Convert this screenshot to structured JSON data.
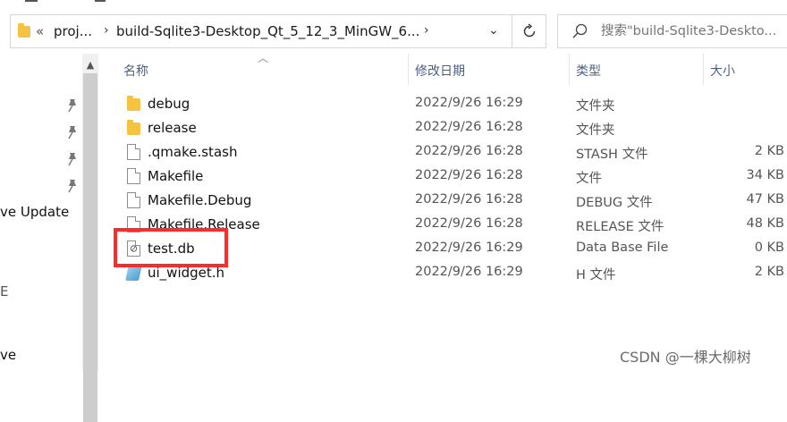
{
  "address_bar": {
    "chevron_left": "«",
    "crumbs": [
      "proj...",
      "build-Sqlite3-Desktop_Qt_5_12_3_MinGW_6..."
    ],
    "separator": "›",
    "dropdown": "⌄"
  },
  "search": {
    "placeholder": "搜索\"build-Sqlite3-Deskto..."
  },
  "nav": {
    "items": [
      "ve Update",
      "E",
      "ve"
    ]
  },
  "columns": {
    "name": "名称",
    "date": "修改日期",
    "type": "类型",
    "size": "大小"
  },
  "files": [
    {
      "name": "debug",
      "date": "2022/9/26 16:29",
      "type": "文件夹",
      "size": "",
      "icon": "folder-icon"
    },
    {
      "name": "release",
      "date": "2022/9/26 16:28",
      "type": "文件夹",
      "size": "",
      "icon": "folder-icon"
    },
    {
      "name": ".qmake.stash",
      "date": "2022/9/26 16:28",
      "type": "STASH 文件",
      "size": "2 KB",
      "icon": "file-icon"
    },
    {
      "name": "Makefile",
      "date": "2022/9/26 16:28",
      "type": "文件",
      "size": "34 KB",
      "icon": "file-icon"
    },
    {
      "name": "Makefile.Debug",
      "date": "2022/9/26 16:28",
      "type": "DEBUG 文件",
      "size": "47 KB",
      "icon": "file-icon"
    },
    {
      "name": "Makefile.Release",
      "date": "2022/9/26 16:28",
      "type": "RELEASE 文件",
      "size": "48 KB",
      "icon": "file-icon"
    },
    {
      "name": "test.db",
      "date": "2022/9/26 16:29",
      "type": "Data Base File",
      "size": "0 KB",
      "icon": "database-file-icon"
    },
    {
      "name": "ui_widget.h",
      "date": "2022/9/26 16:29",
      "type": "H 文件",
      "size": "2 KB",
      "icon": "header-file-icon"
    }
  ],
  "watermark": "CSDN @一棵大柳树",
  "colors": {
    "highlight": "#ff2a2a",
    "folder": "#f6c242",
    "header_text": "#4d6082"
  }
}
